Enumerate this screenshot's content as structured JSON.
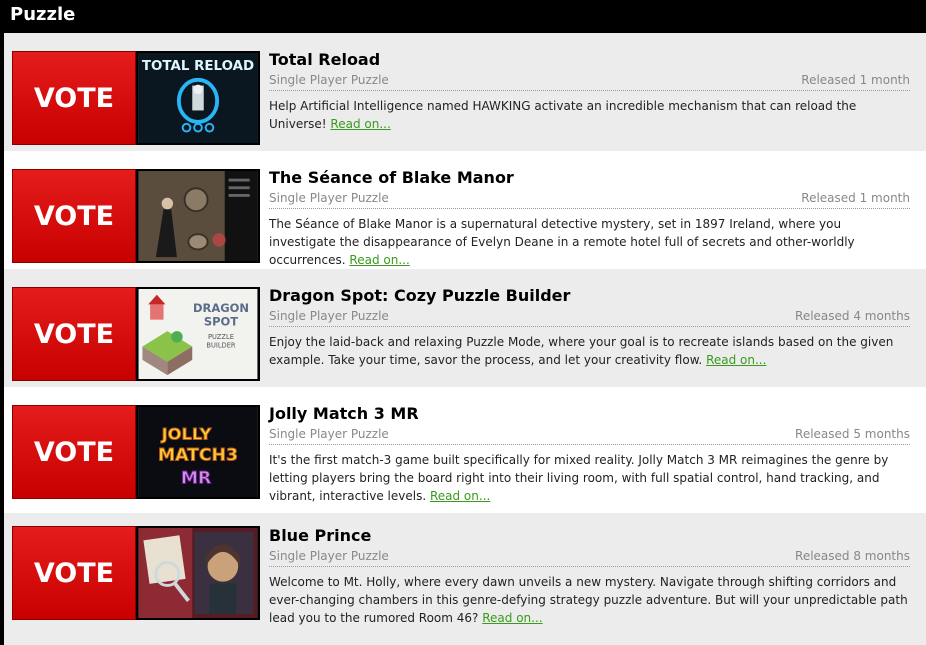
{
  "header": {
    "title": "Puzzle"
  },
  "games": [
    {
      "vote_label": "VOTE",
      "title": "Total Reload",
      "genre": "Single Player Puzzle",
      "released": "Released 1 month",
      "description": "Help Artificial Intelligence named HAWKING activate an incredible mechanism that can reload the Universe!",
      "read_on": "Read on...",
      "thumb_text": "TOTAL RELOAD"
    },
    {
      "vote_label": "VOTE",
      "title": "The Séance of Blake Manor",
      "genre": "Single Player Puzzle",
      "released": "Released 1 month",
      "description": "The Séance of Blake Manor is a supernatural detective mystery, set in 1897 Ireland, where you investigate the disappearance of Evelyn Deane in a remote hotel full of secrets and other-worldly occurrences.",
      "read_on": "Read on..."
    },
    {
      "vote_label": "VOTE",
      "title": "Dragon Spot: Cozy Puzzle Builder",
      "genre": "Single Player Puzzle",
      "released": "Released 4 months",
      "description": "Enjoy the laid-back and relaxing Puzzle Mode, where your goal is to recreate islands based on the given example. Take your time, savor the process, and let your creativity flow.",
      "read_on": "Read on...",
      "thumb_text": [
        "DRAGON",
        "SPOT",
        "PUZZLE",
        "BUILDER"
      ]
    },
    {
      "vote_label": "VOTE",
      "title": "Jolly Match 3 MR",
      "genre": "Single Player Puzzle",
      "released": "Released 5 months",
      "description": "It's the first match-3 game built specifically for mixed reality. Jolly Match 3 MR reimagines the genre by letting players bring the board right into their living room, with full spatial control, hand tracking, and vibrant, interactive levels.",
      "read_on": "Read on...",
      "thumb_text": [
        "JOLLY",
        "MATCH3",
        "MR"
      ]
    },
    {
      "vote_label": "VOTE",
      "title": "Blue Prince",
      "genre": "Single Player Puzzle",
      "released": "Released 8 months",
      "description": "Welcome to Mt. Holly, where every dawn unveils a new mystery. Navigate through shifting corridors and ever-changing chambers in this genre-defying strategy puzzle adventure. But will your unpredictable path lead you to the rumored Room 46?",
      "read_on": "Read on..."
    }
  ]
}
